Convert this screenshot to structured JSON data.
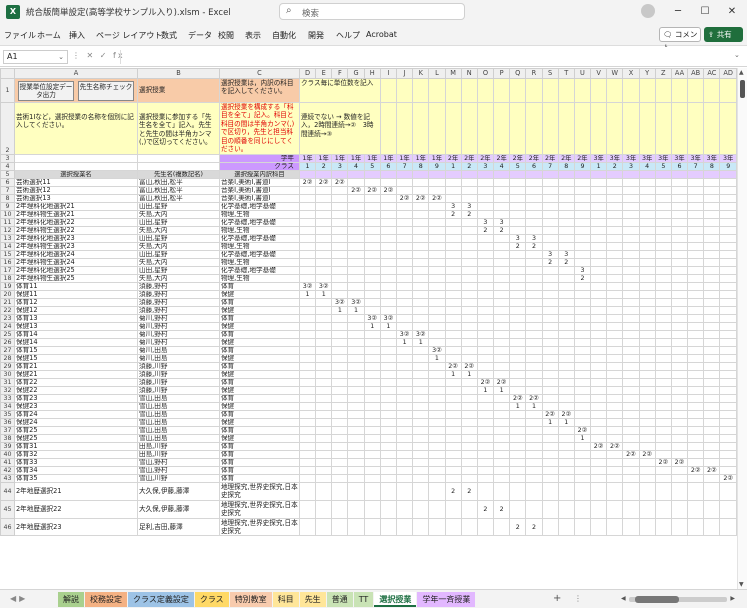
{
  "window": {
    "title": "統合版簡単設定(高等学校サンプル入り).xlsm  -  Excel",
    "app_icon": "X",
    "search_placeholder": "検索",
    "minimize": "─",
    "maximize": "☐",
    "close": "✕"
  },
  "menu": [
    "ファイル",
    "ホーム",
    "挿入",
    "ページ レイアウト",
    "数式",
    "データ",
    "校閲",
    "表示",
    "自動化",
    "開発",
    "ヘルプ",
    "Acrobat"
  ],
  "comment_label": "コメント",
  "share_label": "共有",
  "formula": {
    "namebox": "A1",
    "icons": "⋮  ✕  ✓  fx",
    "value": ""
  },
  "grid": {
    "columns": [
      "A",
      "B",
      "C",
      "D",
      "E",
      "F",
      "G",
      "H",
      "I",
      "J",
      "K",
      "L",
      "M",
      "N",
      "O",
      "P",
      "Q",
      "R",
      "S",
      "T",
      "U",
      "V",
      "W",
      "X",
      "Y",
      "Z",
      "AA",
      "AB",
      "AC",
      "AD"
    ],
    "buttons": [
      "授業単位設定データ出力",
      "先生名称チェック"
    ],
    "b1": "選択授業",
    "c1": "選択授業は，内訳の科目を記入してください。",
    "d1": "クラス毎に単位数を記入",
    "a2": "芸術1Iなど，選択授業の名称を個別に記入してください。",
    "b2": "選択授業に参加する「先生名を全て」記入。先生と先生の間は半角カンマ(,)で区切ってください。",
    "c2": "選択授業を構成する「科目を全て」記入。科目と科目の間は半角カンマ(,)で区切り，先生と担当科目の順番を同じにしてください。",
    "d2": "連続でない → 数値を記入，2時間連続→②　3時間連続→③",
    "row3_label": "学年",
    "row4_label": "クラス",
    "grades": [
      "1年",
      "1年",
      "1年",
      "1年",
      "1年",
      "1年",
      "1年",
      "1年",
      "1年",
      "2年",
      "2年",
      "2年",
      "2年",
      "2年",
      "2年",
      "2年",
      "2年",
      "2年",
      "3年",
      "3年",
      "3年",
      "3年",
      "3年",
      "3年",
      "3年",
      "3年",
      "3年"
    ],
    "classes": [
      "1",
      "2",
      "3",
      "4",
      "5",
      "6",
      "7",
      "8",
      "9",
      "1",
      "2",
      "3",
      "4",
      "5",
      "6",
      "7",
      "8",
      "9",
      "1",
      "2",
      "3",
      "4",
      "5",
      "6",
      "7",
      "8",
      "9"
    ],
    "row5": [
      "選択授業名",
      "先生名(複数記名)",
      "選択授業内訳科目"
    ],
    "rows": [
      {
        "n": "6",
        "a": "芸術選択11",
        "b": "富山,秋田,松平",
        "c": "音楽Ⅰ,美術Ⅰ,書道Ⅰ",
        "v": {
          "0": "2②",
          "1": "2②",
          "2": "2②"
        }
      },
      {
        "n": "7",
        "a": "芸術選択12",
        "b": "富山,秋田,松平",
        "c": "音楽Ⅰ,美術Ⅰ,書道Ⅰ",
        "v": {
          "3": "2②",
          "4": "2②",
          "5": "2②"
        }
      },
      {
        "n": "8",
        "a": "芸術選択13",
        "b": "富山,秋田,松平",
        "c": "音楽Ⅰ,美術Ⅰ,書道Ⅰ",
        "v": {
          "6": "2②",
          "7": "2②",
          "8": "2②"
        }
      },
      {
        "n": "9",
        "a": "2年理科化地選択21",
        "b": "山田,星野",
        "c": "化学基礎,地学基礎",
        "v": {
          "9": "3",
          "10": "3"
        }
      },
      {
        "n": "10",
        "a": "2年理科物生選択21",
        "b": "矢島,大内",
        "c": "物理,生物",
        "v": {
          "9": "2",
          "10": "2"
        }
      },
      {
        "n": "11",
        "a": "2年理科化地選択22",
        "b": "山田,星野",
        "c": "化学基礎,地学基礎",
        "v": {
          "11": "3",
          "12": "3"
        }
      },
      {
        "n": "12",
        "a": "2年理科物生選択22",
        "b": "矢島,大内",
        "c": "物理,生物",
        "v": {
          "11": "2",
          "12": "2"
        }
      },
      {
        "n": "13",
        "a": "2年理科化地選択23",
        "b": "山田,星野",
        "c": "化学基礎,地学基礎",
        "v": {
          "13": "3",
          "14": "3"
        }
      },
      {
        "n": "14",
        "a": "2年理科物生選択23",
        "b": "矢島,大内",
        "c": "物理,生物",
        "v": {
          "13": "2",
          "14": "2"
        }
      },
      {
        "n": "15",
        "a": "2年理科化地選択24",
        "b": "山田,星野",
        "c": "化学基礎,地学基礎",
        "v": {
          "15": "3",
          "16": "3"
        }
      },
      {
        "n": "16",
        "a": "2年理科物生選択24",
        "b": "矢島,大内",
        "c": "物理,生物",
        "v": {
          "15": "2",
          "16": "2"
        }
      },
      {
        "n": "17",
        "a": "2年理科化地選択25",
        "b": "山田,星野",
        "c": "化学基礎,地学基礎",
        "v": {
          "17": "3"
        }
      },
      {
        "n": "18",
        "a": "2年理科物生選択25",
        "b": "矢島,大内",
        "c": "物理,生物",
        "v": {
          "17": "2"
        }
      },
      {
        "n": "19",
        "a": "体育11",
        "b": "須藤,野村",
        "c": "体育",
        "v": {
          "0": "3②",
          "1": "3②"
        }
      },
      {
        "n": "20",
        "a": "保健11",
        "b": "須藤,野村",
        "c": "保健",
        "v": {
          "0": "1",
          "1": "1"
        }
      },
      {
        "n": "21",
        "a": "体育12",
        "b": "須藤,野村",
        "c": "体育",
        "v": {
          "2": "3②",
          "3": "3②"
        }
      },
      {
        "n": "22",
        "a": "保健12",
        "b": "須藤,野村",
        "c": "保健",
        "v": {
          "2": "1",
          "3": "1"
        }
      },
      {
        "n": "23",
        "a": "体育13",
        "b": "菊川,野村",
        "c": "体育",
        "v": {
          "4": "3②",
          "5": "3②"
        }
      },
      {
        "n": "24",
        "a": "保健13",
        "b": "菊川,野村",
        "c": "保健",
        "v": {
          "4": "1",
          "5": "1"
        }
      },
      {
        "n": "25",
        "a": "体育14",
        "b": "菊川,野村",
        "c": "体育",
        "v": {
          "6": "3②",
          "7": "3②"
        }
      },
      {
        "n": "26",
        "a": "保健14",
        "b": "菊川,野村",
        "c": "保健",
        "v": {
          "6": "1",
          "7": "1"
        }
      },
      {
        "n": "27",
        "a": "体育15",
        "b": "菊川,田島",
        "c": "体育",
        "v": {
          "8": "3②"
        }
      },
      {
        "n": "28",
        "a": "保健15",
        "b": "菊川,田島",
        "c": "保健",
        "v": {
          "8": "1"
        }
      },
      {
        "n": "29",
        "a": "体育21",
        "b": "須藤,川野",
        "c": "体育",
        "v": {
          "9": "2②",
          "10": "2②"
        }
      },
      {
        "n": "30",
        "a": "保健21",
        "b": "須藤,川野",
        "c": "保健",
        "v": {
          "9": "1",
          "10": "1"
        }
      },
      {
        "n": "31",
        "a": "体育22",
        "b": "須藤,川野",
        "c": "体育",
        "v": {
          "11": "2②",
          "12": "2②"
        }
      },
      {
        "n": "32",
        "a": "保健22",
        "b": "須藤,川野",
        "c": "保健",
        "v": {
          "11": "1",
          "12": "1"
        }
      },
      {
        "n": "33",
        "a": "体育23",
        "b": "雪山,田島",
        "c": "体育",
        "v": {
          "13": "2②",
          "14": "2②"
        }
      },
      {
        "n": "34",
        "a": "保健23",
        "b": "雪山,田島",
        "c": "保健",
        "v": {
          "13": "1",
          "14": "1"
        }
      },
      {
        "n": "35",
        "a": "体育24",
        "b": "雪山,田島",
        "c": "体育",
        "v": {
          "15": "2②",
          "16": "2②"
        }
      },
      {
        "n": "36",
        "a": "保健24",
        "b": "雪山,田島",
        "c": "保健",
        "v": {
          "15": "1",
          "16": "1"
        }
      },
      {
        "n": "37",
        "a": "体育25",
        "b": "雪山,田島",
        "c": "体育",
        "v": {
          "17": "2②"
        }
      },
      {
        "n": "38",
        "a": "保健25",
        "b": "雪山,田島",
        "c": "保健",
        "v": {
          "17": "1"
        }
      },
      {
        "n": "39",
        "a": "体育31",
        "b": "田島,川野",
        "c": "体育",
        "v": {
          "18": "2②",
          "19": "2②"
        }
      },
      {
        "n": "40",
        "a": "体育32",
        "b": "田島,川野",
        "c": "体育",
        "v": {
          "20": "2②",
          "21": "2②"
        }
      },
      {
        "n": "41",
        "a": "体育33",
        "b": "雪山,野村",
        "c": "体育",
        "v": {
          "22": "2②",
          "23": "2②"
        }
      },
      {
        "n": "42",
        "a": "体育34",
        "b": "雪山,野村",
        "c": "体育",
        "v": {
          "24": "2②",
          "25": "2②"
        }
      },
      {
        "n": "43",
        "a": "体育35",
        "b": "雪山,川野",
        "c": "体育",
        "v": {
          "26": "2②"
        }
      },
      {
        "n": "44",
        "a": "2年地歴選択21",
        "b": "大久保,伊藤,藤澤",
        "c": "地理探究,世界史探究,日本史探究",
        "tall": true,
        "v": {
          "9": "2",
          "10": "2"
        }
      },
      {
        "n": "45",
        "a": "2年地歴選択22",
        "b": "大久保,伊藤,藤澤",
        "c": "地理探究,世界史探究,日本史探究",
        "tall": true,
        "v": {
          "11": "2",
          "12": "2"
        }
      },
      {
        "n": "46",
        "a": "2年地歴選択23",
        "b": "足利,吉田,藤澤",
        "c": "地理探究,世界史探究,日本史探究",
        "tall": true,
        "v": {
          "13": "2",
          "14": "2"
        }
      }
    ]
  },
  "tabs": [
    {
      "label": "解説",
      "color": "#a9d08e"
    },
    {
      "label": "校務設定",
      "color": "#f4b183"
    },
    {
      "label": "クラス定義設定",
      "color": "#9dc3e6"
    },
    {
      "label": "クラス",
      "color": "#ffd966"
    },
    {
      "label": "特別教室",
      "color": "#f8cbad"
    },
    {
      "label": "科目",
      "color": "#ffe699"
    },
    {
      "label": "先生",
      "color": "#ffe699"
    },
    {
      "label": "普通",
      "color": "#c9e3b5"
    },
    {
      "label": "TT",
      "color": "#c9e3b5"
    },
    {
      "label": "選択授業",
      "color": "#ffffff"
    },
    {
      "label": "学年一斉授業",
      "color": "#e2b8ff"
    }
  ],
  "add_sheet": "+",
  "colors": {
    "accent": "#1d6f42",
    "header_orange": "#f8cba8",
    "note_yellow": "#ffffc0",
    "grade_purple": "#cc99ff"
  }
}
